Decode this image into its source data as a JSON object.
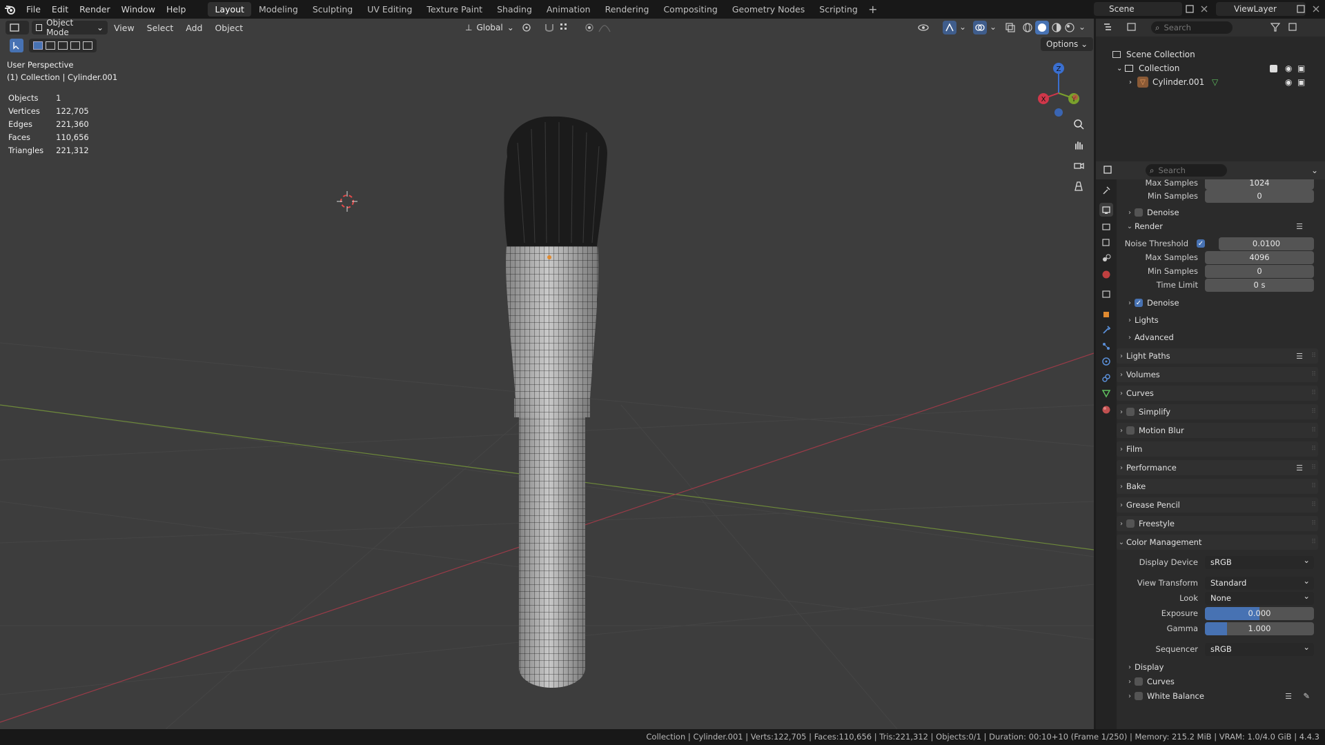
{
  "topbar": {
    "menus": [
      "File",
      "Edit",
      "Render",
      "Window",
      "Help"
    ],
    "workspaces": [
      "Layout",
      "Modeling",
      "Sculpting",
      "UV Editing",
      "Texture Paint",
      "Shading",
      "Animation",
      "Rendering",
      "Compositing",
      "Geometry Nodes",
      "Scripting"
    ],
    "active_workspace": "Layout",
    "scene": "Scene",
    "view_layer": "ViewLayer"
  },
  "viewport": {
    "mode": "Object Mode",
    "menus": [
      "View",
      "Select",
      "Add",
      "Object"
    ],
    "orientation": "Global",
    "options": "Options",
    "perspective": "User Perspective",
    "context": "(1) Collection | Cylinder.001",
    "stats": [
      {
        "label": "Objects",
        "value": "1"
      },
      {
        "label": "Vertices",
        "value": "122,705"
      },
      {
        "label": "Edges",
        "value": "221,360"
      },
      {
        "label": "Faces",
        "value": "110,656"
      },
      {
        "label": "Triangles",
        "value": "221,312"
      }
    ],
    "gizmo": {
      "x": "X",
      "y": "Y",
      "z": "Z"
    }
  },
  "outliner": {
    "search_placeholder": "Search",
    "scene_collection": "Scene Collection",
    "collection": "Collection",
    "object": "Cylinder.001"
  },
  "properties": {
    "search_placeholder": "Search",
    "rows": {
      "max_samples_top": {
        "label": "Max Samples",
        "value": "1024"
      },
      "min_samples_top": {
        "label": "Min Samples",
        "value": "0"
      },
      "denoise_viewport": "Denoise",
      "render_panel": "Render",
      "noise_threshold": {
        "label": "Noise Threshold",
        "value": "0.0100"
      },
      "max_samples": {
        "label": "Max Samples",
        "value": "4096"
      },
      "min_samples": {
        "label": "Min Samples",
        "value": "0"
      },
      "time_limit": {
        "label": "Time Limit",
        "value": "0 s"
      },
      "denoise_render": "Denoise",
      "lights": "Lights",
      "advanced": "Advanced"
    },
    "panels": [
      "Light Paths",
      "Volumes",
      "Curves",
      "Simplify",
      "Motion Blur",
      "Film",
      "Performance",
      "Bake",
      "Grease Pencil",
      "Freestyle",
      "Color Management"
    ],
    "color_management": {
      "display_device": {
        "label": "Display Device",
        "value": "sRGB"
      },
      "view_transform": {
        "label": "View Transform",
        "value": "Standard"
      },
      "look": {
        "label": "Look",
        "value": "None"
      },
      "exposure": {
        "label": "Exposure",
        "value": "0.000",
        "fill": 0.5
      },
      "gamma": {
        "label": "Gamma",
        "value": "1.000",
        "fill": 0.2
      },
      "sequencer": {
        "label": "Sequencer",
        "value": "sRGB"
      },
      "subpanels": [
        "Display",
        "Curves",
        "White Balance"
      ]
    }
  },
  "statusbar": {
    "text": "Collection | Cylinder.001 | Verts:122,705 | Faces:110,656 | Tris:221,312 | Objects:0/1 | Duration: 00:10+10 (Frame 1/250) | Memory: 215.2 MiB | VRAM: 1.0/4.0 GiB | 4.4.3"
  }
}
